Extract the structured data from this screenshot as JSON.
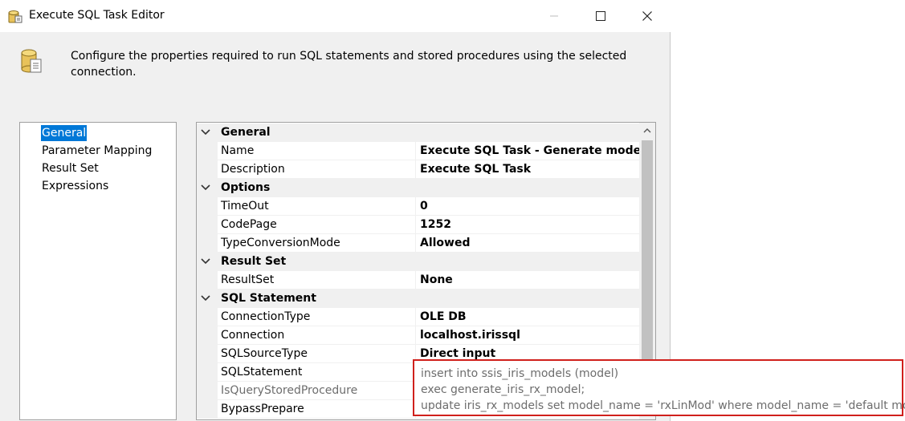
{
  "window": {
    "title": "Execute SQL Task Editor",
    "description": "Configure the properties required to run SQL statements and stored procedures using the selected connection."
  },
  "nav": {
    "items": [
      {
        "label": "General",
        "selected": true
      },
      {
        "label": "Parameter Mapping",
        "selected": false
      },
      {
        "label": "Result Set",
        "selected": false
      },
      {
        "label": "Expressions",
        "selected": false
      }
    ]
  },
  "grid": {
    "categories": [
      {
        "label": "General",
        "properties": [
          {
            "name": "Name",
            "value": "Execute SQL Task  - Generate model"
          },
          {
            "name": "Description",
            "value": "Execute SQL Task"
          }
        ]
      },
      {
        "label": "Options",
        "properties": [
          {
            "name": "TimeOut",
            "value": "0"
          },
          {
            "name": "CodePage",
            "value": "1252"
          },
          {
            "name": "TypeConversionMode",
            "value": "Allowed"
          }
        ]
      },
      {
        "label": "Result Set",
        "properties": [
          {
            "name": "ResultSet",
            "value": "None"
          }
        ]
      },
      {
        "label": "SQL Statement",
        "properties": [
          {
            "name": "ConnectionType",
            "value": "OLE DB"
          },
          {
            "name": "Connection",
            "value": "localhost.irissql"
          },
          {
            "name": "SQLSourceType",
            "value": "Direct input"
          },
          {
            "name": "SQLStatement",
            "value": ""
          },
          {
            "name": "IsQueryStoredProcedure",
            "value": "",
            "disabled": true
          },
          {
            "name": "BypassPrepare",
            "value": ""
          }
        ]
      }
    ]
  },
  "sql_statement": {
    "lines": [
      "insert into ssis_iris_models (model)",
      "exec generate_iris_rx_model;",
      "update iris_rx_models set model_name = 'rxLinMod' where model_name = 'default model';"
    ]
  },
  "colors": {
    "highlight_border": "#d0201c",
    "selection": "#0078d7"
  }
}
